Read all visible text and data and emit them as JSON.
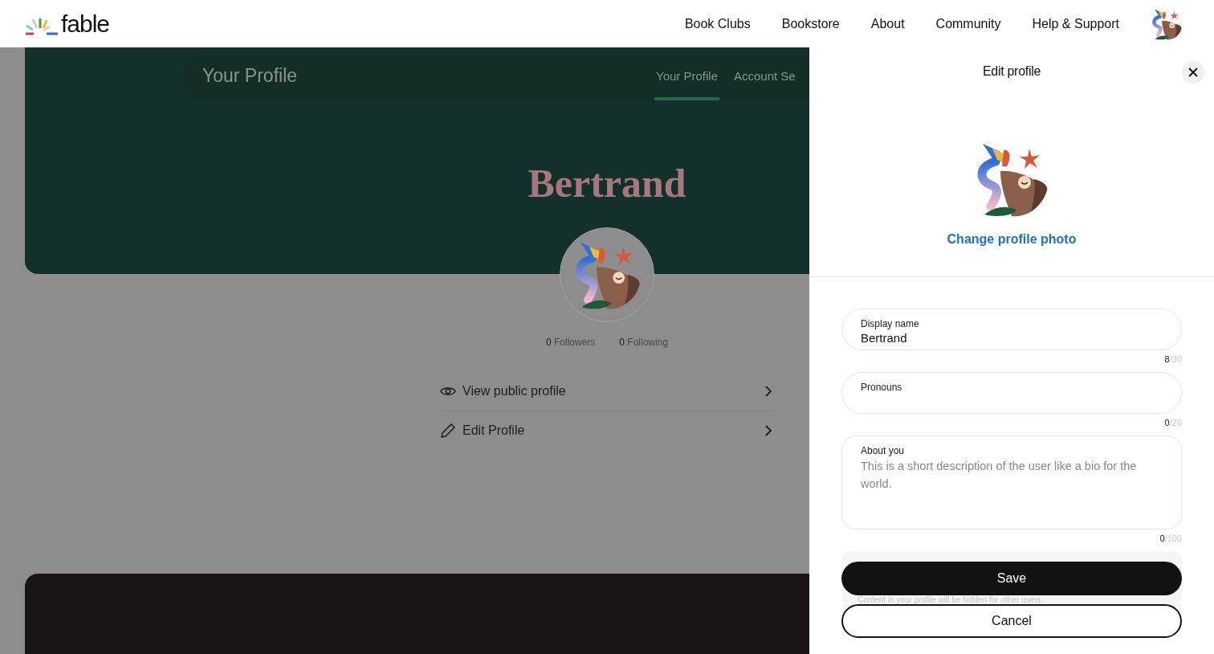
{
  "header": {
    "logo": "fable",
    "nav": [
      "Book Clubs",
      "Bookstore",
      "About",
      "Community",
      "Help & Support"
    ]
  },
  "profile_page": {
    "title": "Your Profile",
    "tabs": [
      {
        "label": "Your Profile",
        "selected": true
      },
      {
        "label": "Account Se",
        "selected": false
      }
    ],
    "name": "Bertrand",
    "stats": [
      {
        "count": "0",
        "label": "Followers"
      },
      {
        "count": "0",
        "label": "Following"
      }
    ],
    "menu": [
      {
        "kind": "view",
        "label": "View public profile"
      },
      {
        "kind": "edit",
        "label": "Edit Profile"
      }
    ]
  },
  "edit_panel": {
    "title": "Edit profile",
    "change_photo": "Change profile photo",
    "fields": [
      {
        "kind": "input",
        "label": "Display name",
        "value": "Bertrand",
        "count": "8",
        "limit": "/30"
      },
      {
        "kind": "input",
        "label": "Pronouns",
        "count": "0",
        "limit": "/20"
      },
      {
        "kind": "textarea",
        "label": "About you",
        "placeholder": "This is a short description of the user like a bio for the world.",
        "count": "0",
        "limit": "/100"
      }
    ],
    "notice": "Content in your profile will be hidden for other users.",
    "buttons": [
      {
        "kind": "primary",
        "label": "Save"
      },
      {
        "kind": "secondary",
        "label": "Cancel"
      }
    ]
  }
}
